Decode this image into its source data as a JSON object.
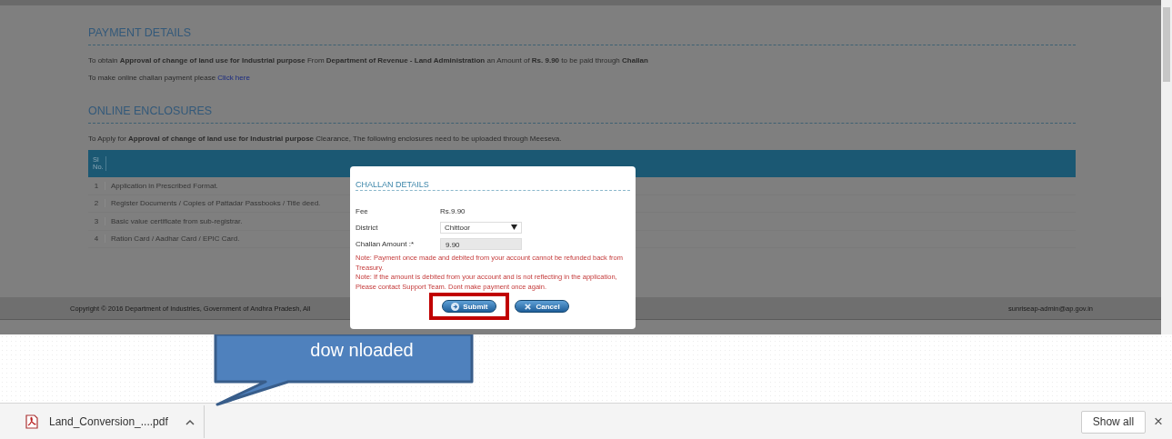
{
  "payment_details": {
    "heading": "PAYMENT DETAILS",
    "text": "To obtain **Approval of change of land use for Industrial purpose** From **Department of Revenue - Land Administration** an Amount of **Rs. 9.90** to be paid through  **Challan**",
    "link_prefix": "To make online challan payment please",
    "link": "Click here"
  },
  "online_enclosures": {
    "heading": "ONLINE ENCLOSURES",
    "intro": "To Apply for **Approval of change of land use for Industrial purpose** Clearance, The following enclosures need to be uploaded through Meeseva.",
    "table": {
      "columns": [
        "Sl No."
      ],
      "rows": [
        {
          "sl": "1",
          "document": "Application in Prescribed Format."
        },
        {
          "sl": "2",
          "document": "Register Documents / Copies of Pattadar Passbooks / Title deed."
        },
        {
          "sl": "3",
          "document": "Basic value certificate from sub-registrar."
        },
        {
          "sl": "4",
          "document": "Ration Card / Aadhar Card / EPIC Card."
        }
      ]
    }
  },
  "footer": {
    "copyright": "Copyright © 2016 Department of Industries, Government of Andhra Pradesh, All",
    "email": "sunriseap-admin@ap.gov.in"
  },
  "dialog": {
    "title": "CHALLAN DETAILS",
    "fields": [
      {
        "kind": "text",
        "label": "Fee",
        "value": "Rs.9.90"
      },
      {
        "kind": "select",
        "label": "District",
        "value": "Chittoor"
      },
      {
        "kind": "input",
        "label": "Challan Amount :*",
        "value": "9.90",
        "disabled": true
      }
    ],
    "notes": [
      "Note: Payment once made and debited from your account cannot be refunded back from Treasury.",
      "Note: If the amount is debited from your account and is not reflecting in the application, Please contact Support Team. Dont make payment once again."
    ],
    "buttons": [
      {
        "kind": "submit",
        "label": "Submit",
        "highlighted": true
      },
      {
        "kind": "cancel",
        "label": "Cancel",
        "highlighted": false
      }
    ]
  },
  "callout": {
    "text": "dow nloaded"
  },
  "download_bar": {
    "file": "Land_Conversion_....pdf",
    "show_all": "Show all",
    "close": "×"
  }
}
